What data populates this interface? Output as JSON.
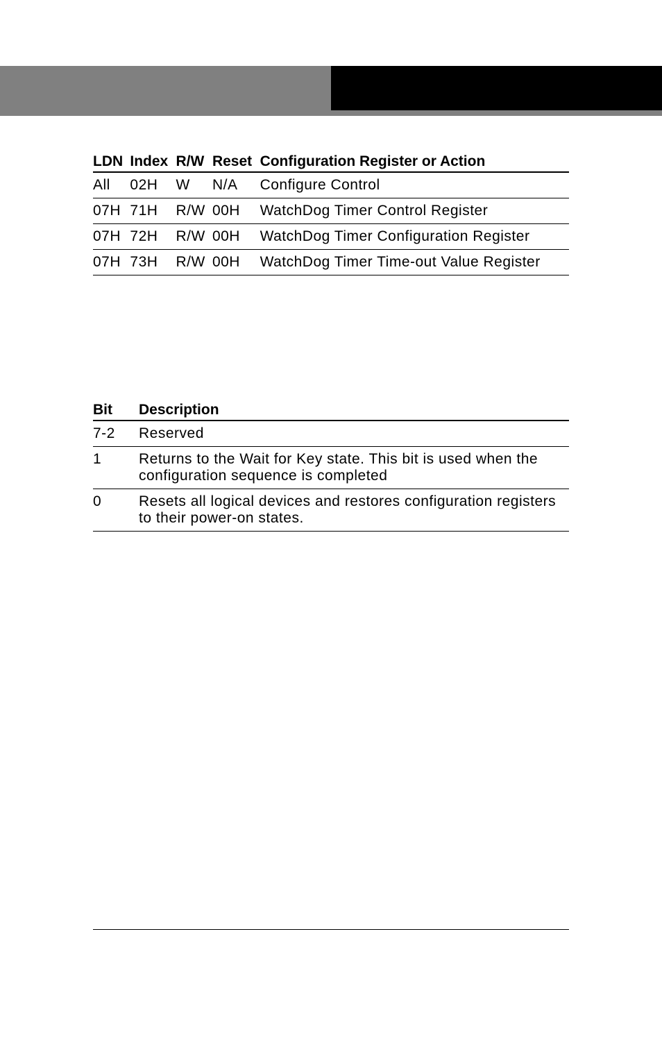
{
  "table1": {
    "headers": {
      "ldn": "LDN",
      "index": "Index",
      "rw": "R/W",
      "reset": "Reset",
      "config": "Configuration Register or Action"
    },
    "rows": [
      {
        "ldn": "All",
        "index": "02H",
        "rw": "W",
        "reset": "N/A",
        "config": "Configure Control"
      },
      {
        "ldn": "07H",
        "index": "71H",
        "rw": "R/W",
        "reset": "00H",
        "config": "WatchDog Timer Control Register"
      },
      {
        "ldn": "07H",
        "index": "72H",
        "rw": "R/W",
        "reset": "00H",
        "config": "WatchDog Timer Configuration Register"
      },
      {
        "ldn": "07H",
        "index": "73H",
        "rw": "R/W",
        "reset": "00H",
        "config": "WatchDog Timer Time-out Value Register"
      }
    ]
  },
  "table2": {
    "headers": {
      "bit": "Bit",
      "desc": "Description"
    },
    "rows": [
      {
        "bit": "7-2",
        "desc": "Reserved"
      },
      {
        "bit": "1",
        "desc": "Returns to the Wait for Key state. This bit is used when the configuration sequence is completed"
      },
      {
        "bit": "0",
        "desc": "Resets all logical devices and restores configuration registers to their power-on states."
      }
    ]
  }
}
